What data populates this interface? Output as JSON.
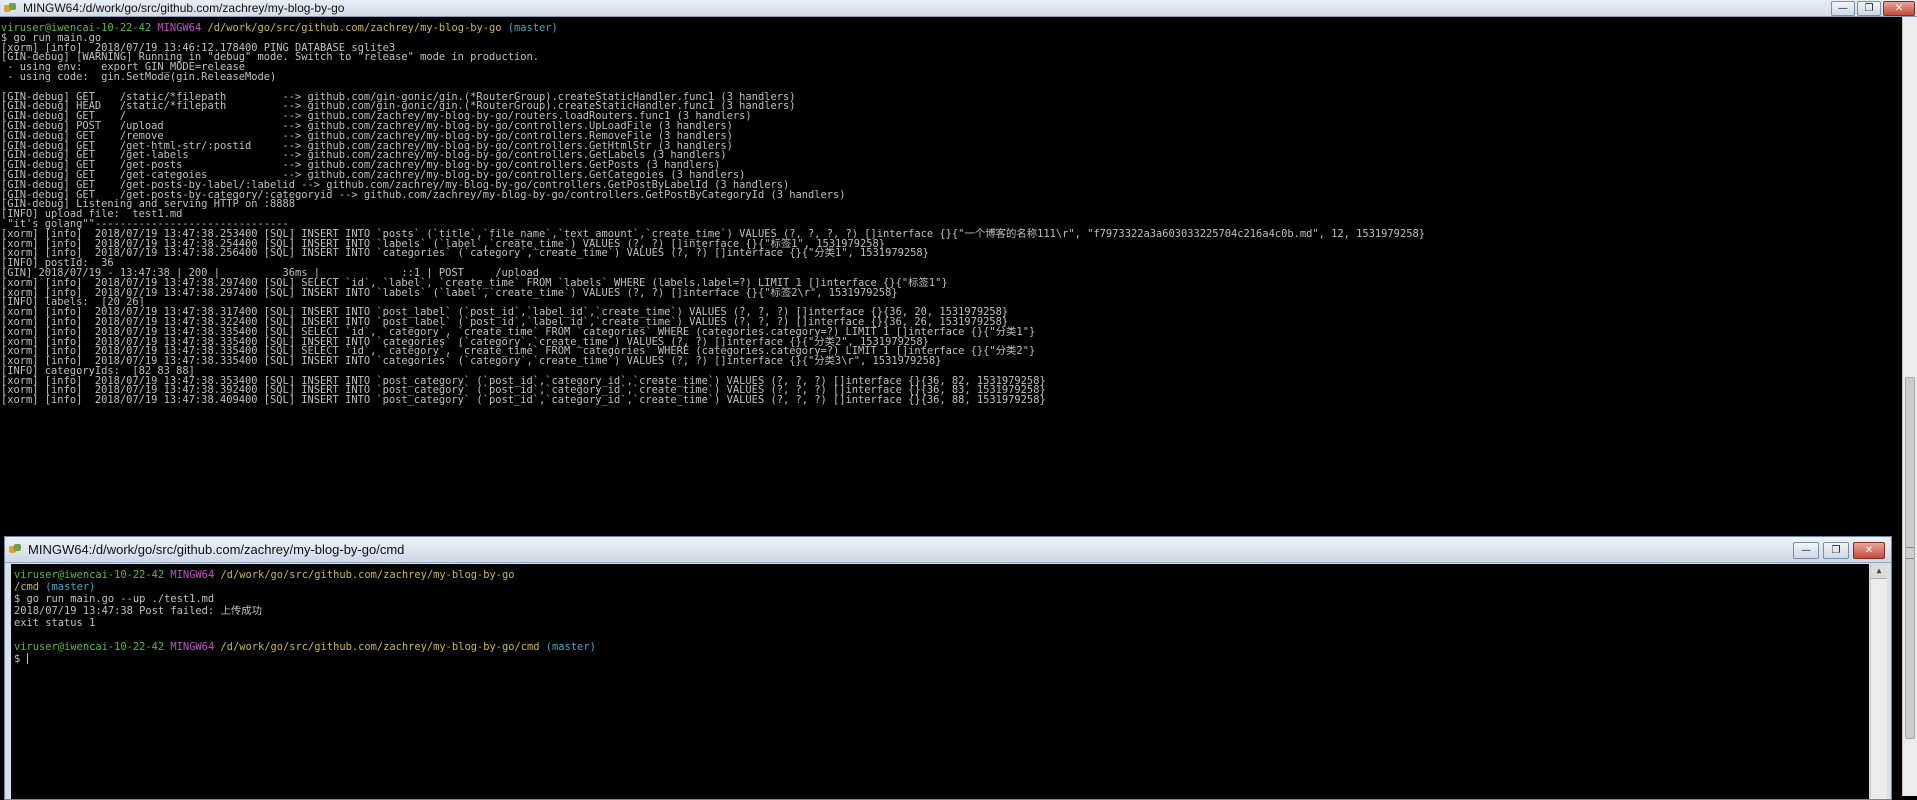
{
  "window_main": {
    "title": "MINGW64:/d/work/go/src/github.com/zachrey/my-blog-by-go",
    "buttons": {
      "minimize": "—",
      "maximize": "❐",
      "close": "✕"
    }
  },
  "terminal_main": {
    "prompt": {
      "user": "viruser@iwencai-10-22-42",
      "shell": "MINGW64",
      "path": "/d/work/go/src/github.com/zachrey/my-blog-by-go",
      "branch": "(master)"
    },
    "command": "$ go run main.go",
    "lines": [
      "[xorm] [info]  2018/07/19 13:46:12.178400 PING DATABASE sqlite3",
      "[GIN-debug] [WARNING] Running in \"debug\" mode. Switch to \"release\" mode in production.",
      " - using env:   export GIN_MODE=release",
      " - using code:  gin.SetMode(gin.ReleaseMode)",
      "",
      "[GIN-debug] GET    /static/*filepath         --> github.com/gin-gonic/gin.(*RouterGroup).createStaticHandler.func1 (3 handlers)",
      "[GIN-debug] HEAD   /static/*filepath         --> github.com/gin-gonic/gin.(*RouterGroup).createStaticHandler.func1 (3 handlers)",
      "[GIN-debug] GET    /                         --> github.com/zachrey/my-blog-by-go/routers.loadRouters.func1 (3 handlers)",
      "[GIN-debug] POST   /upload                   --> github.com/zachrey/my-blog-by-go/controllers.UpLoadFile (3 handlers)",
      "[GIN-debug] GET    /remove                   --> github.com/zachrey/my-blog-by-go/controllers.RemoveFile (3 handlers)",
      "[GIN-debug] GET    /get-html-str/:postid     --> github.com/zachrey/my-blog-by-go/controllers.GetHtmlStr (3 handlers)",
      "[GIN-debug] GET    /get-labels               --> github.com/zachrey/my-blog-by-go/controllers.GetLabels (3 handlers)",
      "[GIN-debug] GET    /get-posts                --> github.com/zachrey/my-blog-by-go/controllers.GetPosts (3 handlers)",
      "[GIN-debug] GET    /get-categoies            --> github.com/zachrey/my-blog-by-go/controllers.GetCategoies (3 handlers)",
      "[GIN-debug] GET    /get-posts-by-label/:labelid --> github.com/zachrey/my-blog-by-go/controllers.GetPostByLabelId (3 handlers)",
      "[GIN-debug] GET    /get-posts-by-category/:categoryid --> github.com/zachrey/my-blog-by-go/controllers.GetPostByCategoryId (3 handlers)",
      "[GIN-debug] Listening and serving HTTP on :8888",
      "[INFO] upload file:  test1.md",
      " \"it's golang\"\"-------------------------------",
      "[xorm] [info]  2018/07/19 13:47:38.253400 [SQL] INSERT INTO `posts` (`title`,`file_name`,`text_amount`,`create_time`) VALUES (?, ?, ?, ?) []interface {}{\"一个博客的名称111\\r\", \"f7973322a3a603033225704c216a4c0b.md\", 12, 1531979258}",
      "[xorm] [info]  2018/07/19 13:47:38.254400 [SQL] INSERT INTO `labels` (`label`,`create_time`) VALUES (?, ?) []interface {}{\"标签1\", 1531979258}",
      "[xorm] [info]  2018/07/19 13:47:38.256400 [SQL] INSERT INTO `categories` (`category`,`create_time`) VALUES (?, ?) []interface {}{\"分类1\", 1531979258}",
      "[INFO] postId:  36",
      "[GIN] 2018/07/19 - 13:47:38 | 200 |          36ms |             ::1 | POST     /upload",
      "[xorm] [info]  2018/07/19 13:47:38.297400 [SQL] SELECT `id`, `label`, `create_time` FROM `labels` WHERE (labels.label=?) LIMIT 1 []interface {}{\"标签1\"}",
      "[xorm] [info]  2018/07/19 13:47:38.297400 [SQL] INSERT INTO `labels` (`label`,`create_time`) VALUES (?, ?) []interface {}{\"标签2\\r\", 1531979258}",
      "[INFO] labels:  [20 26]",
      "[xorm] [info]  2018/07/19 13:47:38.317400 [SQL] INSERT INTO `post_label` (`post_id`,`label_id`,`create_time`) VALUES (?, ?, ?) []interface {}{36, 20, 1531979258}",
      "[xorm] [info]  2018/07/19 13:47:38.322400 [SQL] INSERT INTO `post_label` (`post_id`,`label_id`,`create_time`) VALUES (?, ?, ?) []interface {}{36, 26, 1531979258}",
      "[xorm] [info]  2018/07/19 13:47:38.335400 [SQL] SELECT `id`, `category`, `create_time` FROM `categories` WHERE (categories.category=?) LIMIT 1 []interface {}{\"分类1\"}",
      "[xorm] [info]  2018/07/19 13:47:38.335400 [SQL] INSERT INTO `categories` (`category`,`create_time`) VALUES (?, ?) []interface {}{\"分类2\", 1531979258}",
      "[xorm] [info]  2018/07/19 13:47:38.335400 [SQL] SELECT `id`, `category`, `create_time` FROM `categories` WHERE (categories.category=?) LIMIT 1 []interface {}{\"分类2\"}",
      "[xorm] [info]  2018/07/19 13:47:38.335400 [SQL] INSERT INTO `categories` (`category`,`create_time`) VALUES (?, ?) []interface {}{\"分类3\\r\", 1531979258}",
      "[INFO] categoryIds:  [82 83 88]",
      "[xorm] [info]  2018/07/19 13:47:38.353400 [SQL] INSERT INTO `post_category` (`post_id`,`category_id`,`create_time`) VALUES (?, ?, ?) []interface {}{36, 82, 1531979258}",
      "[xorm] [info]  2018/07/19 13:47:38.392400 [SQL] INSERT INTO `post_category` (`post_id`,`category_id`,`create_time`) VALUES (?, ?, ?) []interface {}{36, 83, 1531979258}",
      "[xorm] [info]  2018/07/19 13:47:38.409400 [SQL] INSERT INTO `post_category` (`post_id`,`category_id`,`create_time`) VALUES (?, ?, ?) []interface {}{36, 88, 1531979258}"
    ]
  },
  "window_cmd": {
    "title": "MINGW64:/d/work/go/src/github.com/zachrey/my-blog-by-go/cmd",
    "buttons": {
      "minimize": "—",
      "maximize": "❐",
      "close": "✕"
    }
  },
  "terminal_cmd": {
    "prompt1": {
      "user": "viruser@iwencai-10-22-42",
      "shell": "MINGW64",
      "path": "/d/work/go/src/github.com/zachrey/my-blog-by-go",
      "path_cont": "/cmd",
      "branch": "(master)"
    },
    "command": "$ go run main.go --up ./test1.md",
    "output": [
      "2018/07/19 13:47:38 Post failed: 上传成功",
      "exit status 1"
    ],
    "prompt2": {
      "user": "viruser@iwencai-10-22-42",
      "shell": "MINGW64",
      "path": "/d/work/go/src/github.com/zachrey/my-blog-by-go/cmd",
      "branch": "(master)"
    },
    "input_prompt": "$ "
  }
}
